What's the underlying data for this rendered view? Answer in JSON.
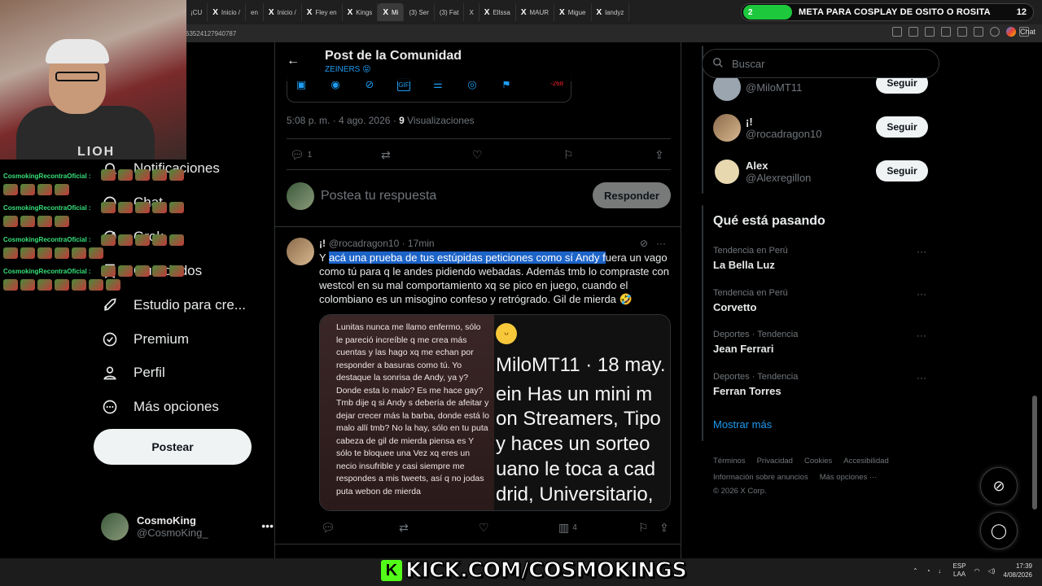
{
  "browser": {
    "tabs": [
      "¡CU",
      "Inicio /",
      "en",
      "Inicio /",
      "Fley en",
      "Kings",
      "Mi",
      "(3) Ser",
      "(3) Fat",
      "X",
      "Ellssa",
      "MAUR",
      "Migue",
      "landyz"
    ],
    "url": "63524127940787",
    "chat_label": "Chat"
  },
  "stream": {
    "goal_count_left": "2",
    "goal_text": "META PARA COSPLAY DE OSITO O ROSITA",
    "goal_count_right": "12",
    "chat_user": "CosmokingRecontraOficial :",
    "shirt_text": "LIOH",
    "kick_text": "KICK.COM/COSMOKINGS"
  },
  "sidebar": {
    "items": [
      {
        "label": "Notificaciones",
        "icon": "bell-icon"
      },
      {
        "label": "Chat",
        "icon": "chat-icon"
      },
      {
        "label": "Grok",
        "icon": "grok-icon"
      },
      {
        "label": "Guardados",
        "icon": "bookmark-icon"
      },
      {
        "label": "Estudio para cre...",
        "icon": "rocket-icon"
      },
      {
        "label": "Premium",
        "icon": "verified-icon"
      },
      {
        "label": "Perfil",
        "icon": "person-icon"
      },
      {
        "label": "Más opciones",
        "icon": "more-icon"
      }
    ],
    "post_button": "Postear",
    "account": {
      "name": "CosmoKing",
      "handle": "@CosmoKing_"
    }
  },
  "main": {
    "title": "Post de la Comunidad",
    "subtitle": "ZEINERS 😝",
    "toolbar_count": "-268",
    "time": "5:08 p. m. · 4 ago. 2026 ·",
    "views_count": "9",
    "views_label": "Visualizaciones",
    "actions": {
      "replies": "1"
    },
    "reply_placeholder": "Postea tu respuesta",
    "reply_button": "Responder",
    "reply_tweet": {
      "name": "¡!",
      "handle_time": "@rocadragon10 · 17min",
      "text_before": "Y ",
      "text_highlight": "acá una prueba de tus estúpidas peticiones como sí Andy f",
      "text_after": "uera un vago como tú para q le andes pidiendo webadas. Además tmb lo compraste con westcol en su mal comportamiento xq se pico en juego, cuando el colombiano es un misogino confeso y retrógrado. Gil de mierda 🤣",
      "views": "4",
      "media_left_text": "Lunitas nunca me llamo enfermo, sólo le pareció increíble q me crea más cuentas y las hago xq me echan por responder a basuras como tú. Yo destaque la sonrisa de Andy, ya y? Donde esta lo malo? Es me hace gay? Tmb dije q si Andy s debería de afeitar y dejar crecer más la barba, donde está lo malo allí tmb? No la hay, sólo en tu puta cabeza de gil de mierda piensa es Y sólo te bloquee una Vez xq eres un necio insufrible y casi siempre me respondes a mis tweets, así q no jodas puta webon de mierda",
      "media_right_lines": [
        "MiloMT11 · 18 may. 2",
        "ein Has un mini m",
        "on Streamers, Tipo",
        "y haces un sorteo",
        "uano le toca a cad",
        "drid, Universitario,"
      ]
    }
  },
  "right": {
    "search_placeholder": "Buscar",
    "who_to_follow": [
      {
        "name": "",
        "handle": "@MiloMT11",
        "button": "Seguir"
      },
      {
        "name": "¡!",
        "handle": "@rocadragon10",
        "button": "Seguir"
      },
      {
        "name": "Alex",
        "handle": "@Alexregillon",
        "button": "Seguir"
      }
    ],
    "trends_title": "Qué está pasando",
    "trends": [
      {
        "category": "Tendencia en Perú",
        "name": "La Bella Luz"
      },
      {
        "category": "Tendencia en Perú",
        "name": "Corvetto"
      },
      {
        "category": "Deportes · Tendencia",
        "name": "Jean Ferrari"
      },
      {
        "category": "Deportes · Tendencia",
        "name": "Ferran Torres"
      }
    ],
    "show_more": "Mostrar más",
    "footer_row1": [
      "Términos",
      "Privacidad",
      "Cookies",
      "Accesibilidad"
    ],
    "footer_row2": [
      "Información sobre anuncios",
      "Más opciones ···"
    ],
    "copyright": "© 2026 X Corp."
  },
  "taskbar": {
    "lang_top": "ESP",
    "lang_bottom": "LAA",
    "time": "17:39",
    "date": "4/08/2026"
  }
}
